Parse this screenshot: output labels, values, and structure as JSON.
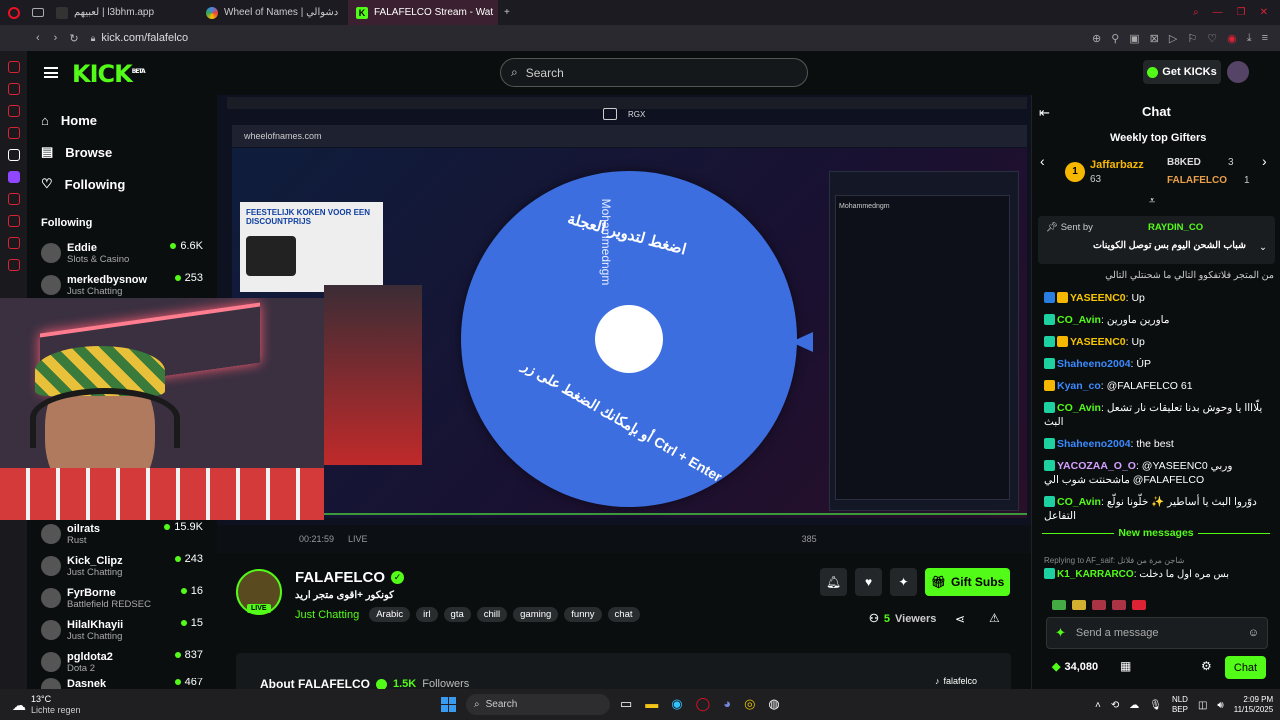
{
  "browser": {
    "tabs": [
      {
        "label": "لعبيهم | l3bhm.app",
        "color": "#333"
      },
      {
        "label": "Wheel of Names | دشوالي",
        "color": "#4285f4"
      },
      {
        "label": "FALAFELCO Stream - Wat",
        "color": "#53fc18"
      }
    ],
    "url": "kick.com/falafelco"
  },
  "header": {
    "logo": "KICK",
    "logo_sup": "BETA",
    "search_placeholder": "Search",
    "get_kicks": "Get KICKs"
  },
  "sidebar": {
    "nav": [
      {
        "label": "Home",
        "icon": "home-icon"
      },
      {
        "label": "Browse",
        "icon": "browse-icon"
      },
      {
        "label": "Following",
        "icon": "heart-icon"
      }
    ],
    "following_title": "Following",
    "channels": [
      {
        "name": "Eddie",
        "category": "Slots & Casino",
        "viewers": "6.6K"
      },
      {
        "name": "merkedbysnow",
        "category": "Just Chatting",
        "viewers": "253"
      },
      {
        "name": "oilrats",
        "category": "Rust",
        "viewers": "15.9K"
      },
      {
        "name": "Kick_Clipz",
        "category": "Just Chatting",
        "viewers": "243"
      },
      {
        "name": "FyrBorne",
        "category": "Battlefield REDSEC",
        "viewers": "16"
      },
      {
        "name": "HilalKhayii",
        "category": "Just Chatting",
        "viewers": "15"
      },
      {
        "name": "pgldota2",
        "category": "Dota 2",
        "viewers": "837"
      },
      {
        "name": "Dasnek",
        "category": "",
        "viewers": "467"
      }
    ]
  },
  "video": {
    "inner_url": "wheelofnames.com",
    "wheel_text_top": "اضغط لتدوير العجلة",
    "wheel_text_bottom": "أو بإمكانك الضغط على زر Ctrl + Enter",
    "wheel_name": "Mohammedngm",
    "entry_name": "Mohammedngm",
    "ad_text": "FEESTELIJK KOKEN VOOR EEN DISCOUNTPRIJS",
    "overlay_label": "RGX",
    "inner_time": "00:21:59",
    "inner_live": "LIVE",
    "inner_count": "385"
  },
  "stream": {
    "channel": "FALAFELCO",
    "title": "كونكور +اقوى متجر اريد",
    "category": "Just Chatting",
    "tags": [
      "Arabic",
      "irl",
      "gta",
      "chill",
      "gaming",
      "funny",
      "chat"
    ],
    "live_badge": "LIVE",
    "gift_subs": "Gift Subs",
    "viewers": "5",
    "viewers_label": "Viewers",
    "about_title": "About FALAFELCO",
    "followers": "1.5K",
    "followers_label": "Followers",
    "tiktok": "falafelco"
  },
  "chat": {
    "title": "Chat",
    "gifters_title": "Weekly top Gifters",
    "gifters": [
      {
        "rank": "1",
        "name": "Jaffarbazz",
        "count": "63"
      },
      {
        "name": "B8KED",
        "count": "3"
      },
      {
        "name": "FALAFELCO",
        "count": "1"
      }
    ],
    "pinned_sent_by": "Sent by",
    "pinned_user": "RAYDIN_CO",
    "pinned_text": "شباب الشحن اليوم بس توصل الكوينات",
    "messages": [
      {
        "user": "",
        "text": "من المتجر فلاتفكوو التالي ما شحنتلي التالي",
        "color": "#ccc"
      },
      {
        "user": "YASEENC0",
        "text": ": Up",
        "color": "#f7c600"
      },
      {
        "user": "CO_Avin",
        "text": ": ماورين ماورين",
        "color": "#53fc18"
      },
      {
        "user": "YASEENC0",
        "text": ": Up",
        "color": "#f7c600"
      },
      {
        "user": "Shaheeno2004",
        "text": ": ÚP",
        "color": "#3a8bff"
      },
      {
        "user": "Kyan_co",
        "text": ": @FALAFELCO 61",
        "color": "#3a8bff"
      },
      {
        "user": "CO_Avin",
        "text": ": يلّاااا يا وحوش بدنا تعليقات نار تشعل البث",
        "color": "#53fc18"
      },
      {
        "user": "Shaheeno2004",
        "text": ": the best",
        "color": "#3a8bff"
      },
      {
        "user": "YACOZAA_O_O",
        "text": ": @YASEENC0 وربي ماشحنتت شوب الي @FALAFELCO",
        "color": "#d5a0ff"
      },
      {
        "user": "CO_Avin",
        "text": ": دوّروا البث يا أساطير ✨ خلّونا نولّع التفاعل",
        "color": "#53fc18"
      }
    ],
    "new_messages": "New messages",
    "reply_label": "Replying to AF_saif: شاجن مرة من فلاتل",
    "reply_user": "K1_KARRARCO",
    "reply_text": ": بس مره اول ما دخلت",
    "input_placeholder": "Send a message",
    "kicks_balance": "34,080",
    "chat_button": "Chat"
  },
  "taskbar": {
    "weather_temp": "13°C",
    "weather_desc": "Lichte regen",
    "search": "Search",
    "lang": "NLD",
    "lang2": "BEP",
    "time": "2:09 PM",
    "date": "11/15/2025"
  },
  "colors": {
    "kick_green": "#53fc18",
    "bg": "#0b0e0f",
    "accent_red": "#d6234a"
  }
}
